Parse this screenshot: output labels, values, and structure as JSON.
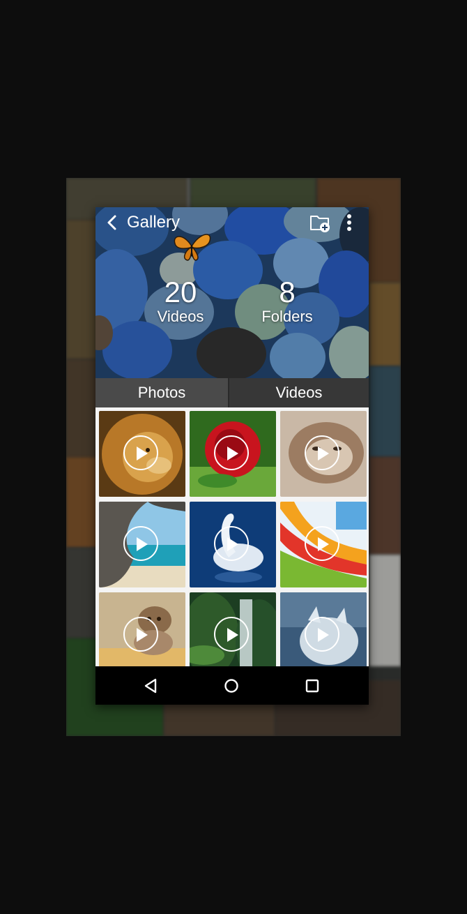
{
  "app": {
    "title": "Gallery",
    "icons": {
      "back": "back-arrow-icon",
      "add_folder": "folder-add-icon",
      "more": "more-vertical-icon"
    }
  },
  "stats": {
    "videos_count": "20",
    "videos_label": "Videos",
    "folders_count": "8",
    "folders_label": "Folders"
  },
  "tabs": [
    {
      "label": "Photos"
    },
    {
      "label": "Videos",
      "selected": true
    }
  ],
  "thumbnails": [
    {
      "subject": "lion"
    },
    {
      "subject": "red-rose"
    },
    {
      "subject": "cat"
    },
    {
      "subject": "beach-cave"
    },
    {
      "subject": "swan"
    },
    {
      "subject": "abstract-rainbow"
    },
    {
      "subject": "kitten"
    },
    {
      "subject": "waterfall"
    },
    {
      "subject": "white-wolf"
    }
  ],
  "navbar": {
    "icons": [
      "back-triangle-icon",
      "home-circle-icon",
      "recents-square-icon"
    ]
  },
  "colors": {
    "page_background": "#0d0d0d",
    "tab_bar": "#3b3b3b",
    "navbar": "#000000",
    "text": "#ffffff"
  }
}
